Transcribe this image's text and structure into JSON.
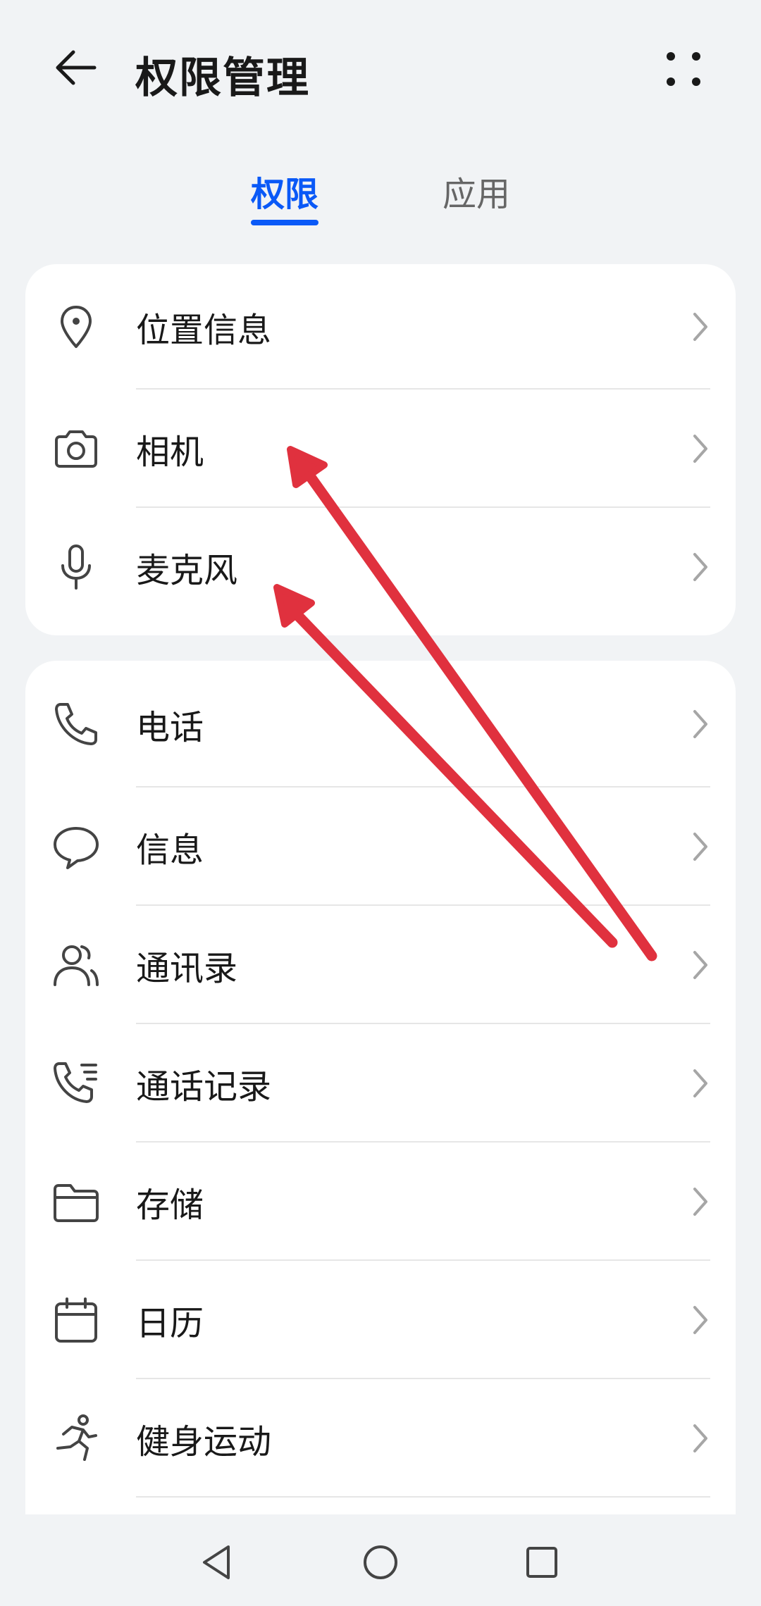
{
  "header": {
    "title": "权限管理",
    "back_icon": "arrow-left-icon",
    "more_icon": "more-dots-icon"
  },
  "tabs": [
    {
      "label": "权限",
      "selected": true
    },
    {
      "label": "应用",
      "selected": false
    }
  ],
  "groups": [
    {
      "items": [
        {
          "label": "位置信息",
          "icon": "location-pin-icon"
        },
        {
          "label": "相机",
          "icon": "camera-icon"
        },
        {
          "label": "麦克风",
          "icon": "microphone-icon"
        }
      ]
    },
    {
      "items": [
        {
          "label": "电话",
          "icon": "phone-icon"
        },
        {
          "label": "信息",
          "icon": "message-bubble-icon"
        },
        {
          "label": "通讯录",
          "icon": "contacts-icon"
        },
        {
          "label": "通话记录",
          "icon": "call-log-icon"
        },
        {
          "label": "存储",
          "icon": "folder-icon"
        },
        {
          "label": "日历",
          "icon": "calendar-icon"
        },
        {
          "label": "健身运动",
          "icon": "running-person-icon"
        }
      ]
    }
  ],
  "colors": {
    "accent": "#0a59f7",
    "background": "#f1f3f5",
    "annotation_arrow": "#e0313e"
  },
  "navigation": [
    "back-triangle-icon",
    "home-circle-icon",
    "recents-square-icon"
  ]
}
